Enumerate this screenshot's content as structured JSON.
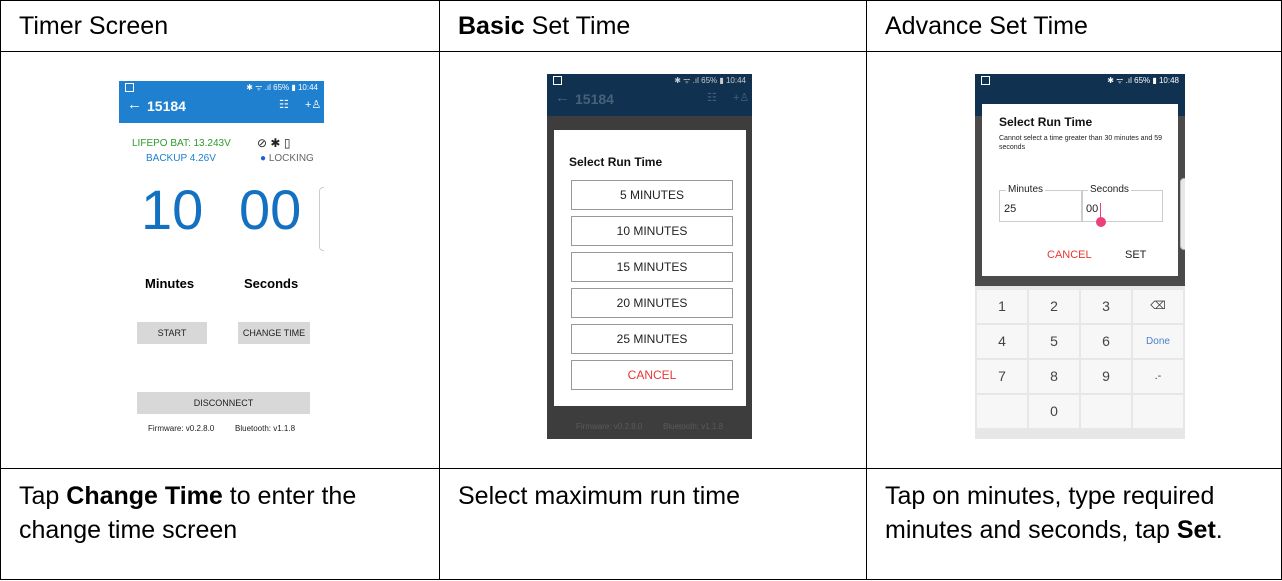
{
  "header": {
    "col1": "Timer Screen",
    "col2_bold": "Basic",
    "col2_rest": " Set Time",
    "col3": "Advance Set Time"
  },
  "phone1": {
    "status": "✱ ᯤ .ıl 65% ▮ 10:44",
    "title": "15184",
    "lifepo": "LIFEPO BAT: 13.243V",
    "backup_label": "BACKUP",
    "backup_value": "4.26V",
    "locking": "LOCKING",
    "minutes_value": "10",
    "seconds_value": "00",
    "minutes_label": "Minutes",
    "seconds_label": "Seconds",
    "start": "START",
    "change_time": "CHANGE TIME",
    "disconnect": "DISCONNECT",
    "firmware": "Firmware: v0.2.8.0",
    "bluetooth": "Bluetooth: v1.1.8"
  },
  "phone2": {
    "status": "✱ ᯤ .ıl 65% ▮ 10:44",
    "title": "15184",
    "dialog_title": "Select Run Time",
    "options": [
      "5 MINUTES",
      "10 MINUTES",
      "15 MINUTES",
      "20 MINUTES",
      "25 MINUTES"
    ],
    "cancel": "CANCEL",
    "firmware": "Firmware: v0.2.8.0",
    "bluetooth": "Bluetooth: v1.1.8"
  },
  "phone3": {
    "status": "✱ ᯤ .ıl 65% ▮ 10:48",
    "dialog_title": "Select Run Time",
    "subtitle": "Cannot select a time greater than 30 minutes and 59 seconds",
    "minutes_label": "Minutes",
    "minutes_value": "25",
    "seconds_label": "Seconds",
    "seconds_value": "00",
    "cancel": "CANCEL",
    "set": "SET",
    "keys": [
      "1",
      "2",
      "3",
      "⌫",
      "4",
      "5",
      "6",
      "Done",
      "7",
      "8",
      "9",
      ".-",
      "",
      "0",
      "",
      ""
    ]
  },
  "captions": {
    "c1_pre": "Tap ",
    "c1_bold": "Change Time",
    "c1_post": " to enter the change time screen",
    "c2": "Select maximum run time",
    "c3_pre": "Tap on minutes, type required minutes and seconds, tap ",
    "c3_bold": "Set",
    "c3_post": "."
  },
  "colors": {
    "primary": "#1E80CF",
    "timer": "#1471C1",
    "lifepo": "#2E9A2E",
    "backup": "#1E80CF",
    "danger": "#E53935",
    "accent_cursor": "#EC407A"
  }
}
